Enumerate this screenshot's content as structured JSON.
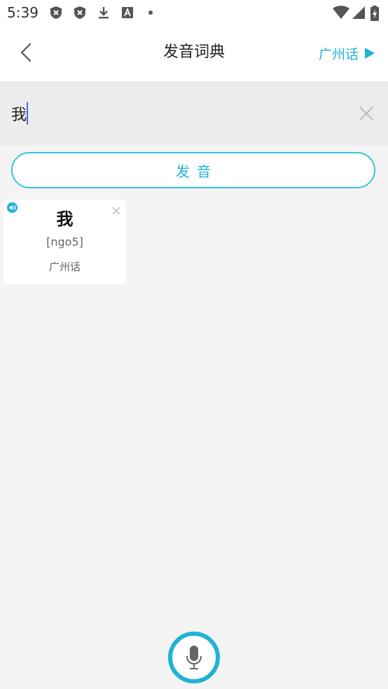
{
  "status_bar": {
    "time": "5:39",
    "icons": [
      "shield-icon",
      "shield-icon",
      "download-icon",
      "font-icon",
      "dot-icon",
      "wifi-icon",
      "signal-icon",
      "battery-charging-icon"
    ]
  },
  "header": {
    "title": "发音词典",
    "dialect": "广州话",
    "back_icon": "chevron-left-icon",
    "dialect_icon": "triangle-right-icon"
  },
  "search": {
    "value": "我",
    "placeholder": "",
    "clear_icon": "close-icon"
  },
  "pronounce_button": {
    "label": "发音"
  },
  "results": [
    {
      "character": "我",
      "pronunciation": "[ngo5]",
      "dialect": "广州话"
    }
  ],
  "mic": {
    "icon": "microphone-icon"
  },
  "colors": {
    "accent": "#1fb3d4",
    "background": "#f4f4f4",
    "search_bg": "#ececec",
    "caret": "#3a6df0"
  }
}
